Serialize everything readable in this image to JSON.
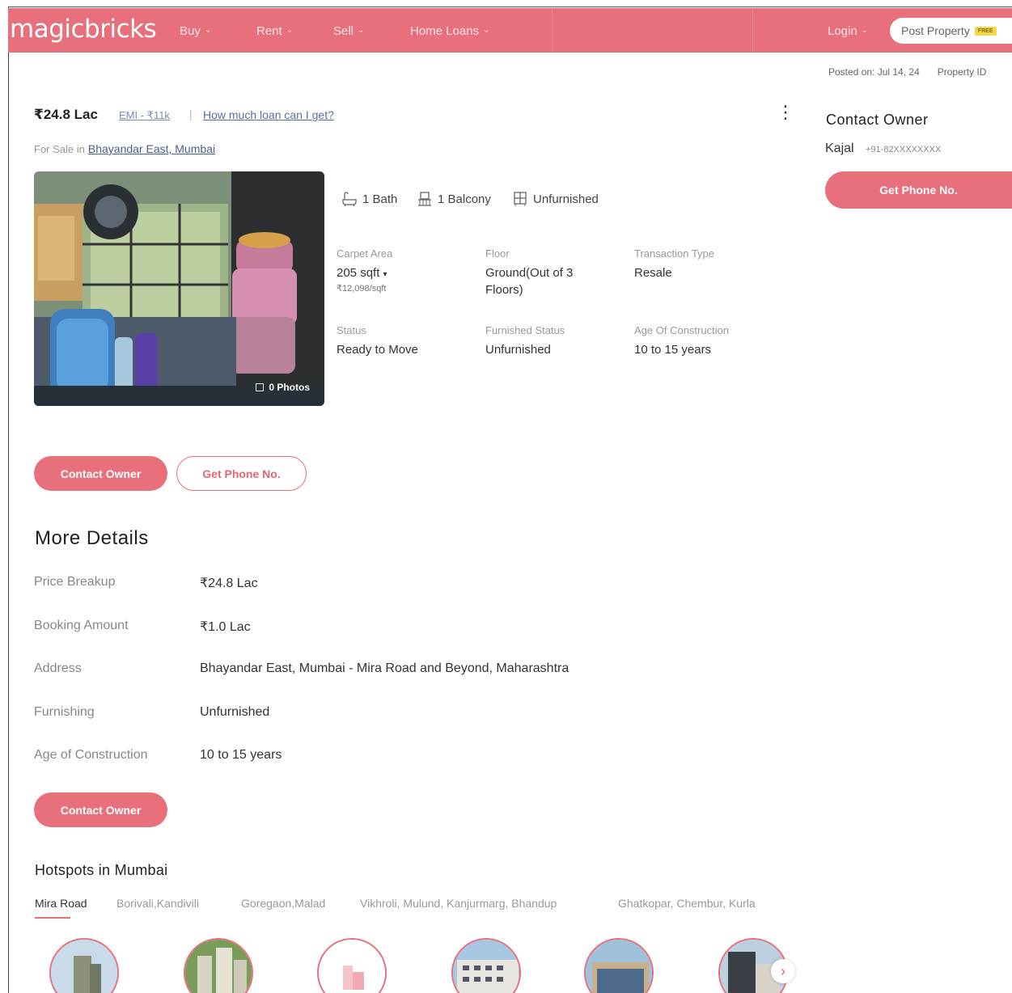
{
  "header": {
    "logo": "magicbricks",
    "nav": [
      "Buy",
      "Rent",
      "Sell",
      "Home Loans"
    ],
    "login": "Login",
    "post_property": "Post Property",
    "post_badge": "FREE"
  },
  "meta": {
    "posted_on": "Posted on: Jul 14, 24",
    "property_id": "Property ID"
  },
  "listing": {
    "price": "₹24.8 Lac",
    "emi": "EMI - ₹11k",
    "separator": "|",
    "loan_link": "How much loan can I get?",
    "for_sale_prefix": "For Sale in",
    "location": "Bhayandar East, Mumbai",
    "photos_label": "0 Photos",
    "amenities": {
      "bath": "1 Bath",
      "balcony": "1 Balcony",
      "furnishing": "Unfurnished"
    },
    "specs": {
      "carpet_area_label": "Carpet Area",
      "carpet_area_value": "205 sqft",
      "carpet_area_rate": "₹12,098/sqft",
      "floor_label": "Floor",
      "floor_value_1": "Ground(Out of 3",
      "floor_value_2": "Floors)",
      "transaction_label": "Transaction Type",
      "transaction_value": "Resale",
      "status_label": "Status",
      "status_value": "Ready to Move",
      "furnished_label": "Furnished Status",
      "furnished_value": "Unfurnished",
      "age_label": "Age Of Construction",
      "age_value": "10 to 15 years"
    },
    "contact_owner_btn": "Contact Owner",
    "get_phone_btn": "Get Phone No."
  },
  "contact_panel": {
    "title": "Contact Owner",
    "name": "Kajal",
    "phone": "+91-82XXXXXXXX",
    "button": "Get Phone No."
  },
  "more_details": {
    "title": "More Details",
    "rows": [
      {
        "label": "Price Breakup",
        "value": "₹24.8 Lac"
      },
      {
        "label": "Booking Amount",
        "value": "₹1.0 Lac"
      },
      {
        "label": "Address",
        "value": "Bhayandar East, Mumbai - Mira Road and Beyond, Maharashtra"
      },
      {
        "label": "Furnishing",
        "value": "Unfurnished"
      },
      {
        "label": "Age of Construction",
        "value": "10 to 15 years"
      }
    ],
    "contact_btn": "Contact Owner"
  },
  "hotspots": {
    "title": "Hotspots in Mumbai",
    "tabs": [
      "Mira Road",
      "Borivali,Kandivili",
      "Goregaon,Malad",
      "Vikhroli, Mulund, Kanjurmarg, Bhandup",
      "Ghatkopar, Chembur, Kurla"
    ],
    "active_tab": "Mira Road"
  },
  "colors": {
    "brand": "#e8707c",
    "link": "#5a6fa0"
  }
}
